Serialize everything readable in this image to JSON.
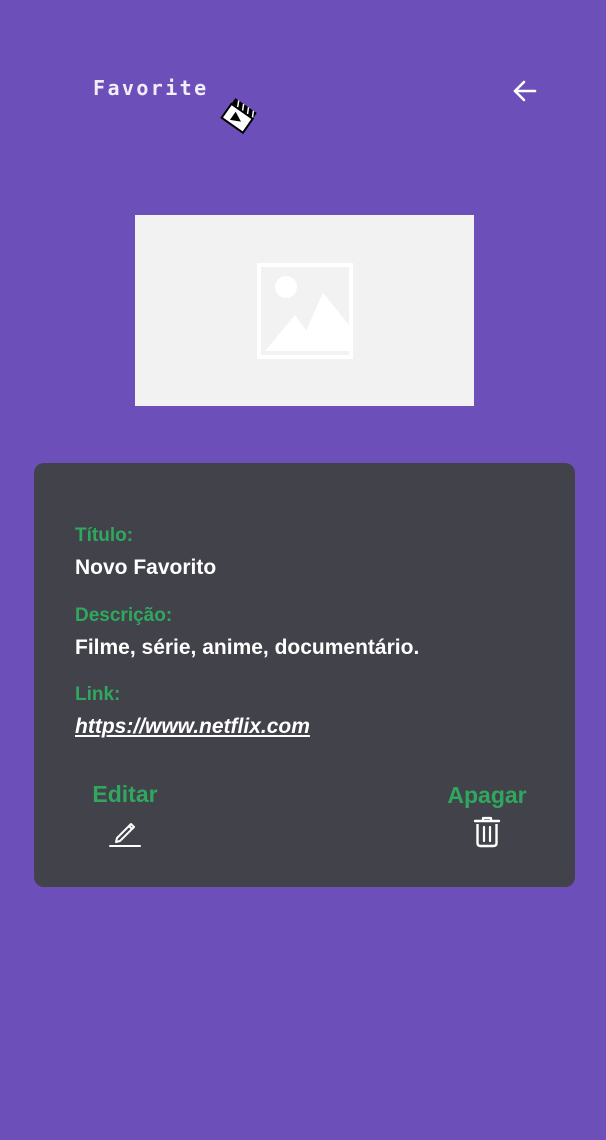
{
  "header": {
    "logo_text": "Favorite",
    "logo_icon": "clapperboard-icon",
    "back_icon": "arrow-left-icon"
  },
  "image": {
    "icon": "image-placeholder-icon"
  },
  "details": {
    "title_label": "Título:",
    "title_value": "Novo Favorito",
    "description_label": "Descrição:",
    "description_value": "Filme, série, anime, documentário.",
    "link_label": "Link:",
    "link_value": "https://www.netflix.com"
  },
  "actions": {
    "edit_label": "Editar",
    "edit_icon": "pencil-icon",
    "delete_label": "Apagar",
    "delete_icon": "trash-icon"
  },
  "colors": {
    "background": "#6c4fb9",
    "card": "#42424b",
    "accent_green": "#2fa85e",
    "placeholder": "#f2f2f2"
  }
}
